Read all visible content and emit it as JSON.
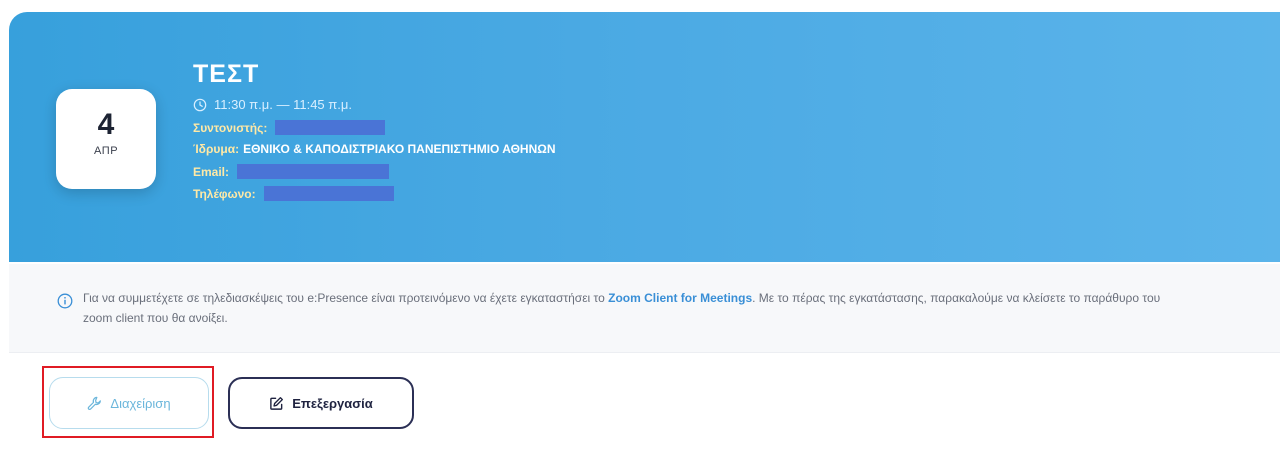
{
  "event": {
    "title": "ΤΕΣΤ",
    "time": "11:30 π.μ. — 11:45 π.μ.",
    "date": {
      "day": "4",
      "month": "ΑΠΡ"
    },
    "coordinator_label": "Συντονιστής:",
    "coordinator_value": "",
    "institution_label": "Ίδρυμα:",
    "institution_value": "ΕΘΝΙΚΟ & ΚΑΠΟΔΙΣΤΡΙΑΚΟ ΠΑΝΕΠΙΣΤΗΜΙΟ ΑΘΗΝΩΝ",
    "email_label": "Email:",
    "email_value": "",
    "phone_label": "Τηλέφωνο:",
    "phone_value": ""
  },
  "notice": {
    "text_before": "Για να συμμετέχετε σε τηλεδιασκέψεις του e:Presence είναι προτεινόμενο να έχετε εγκαταστήσει το ",
    "link": "Zoom Client for Meetings",
    "text_after": ". Με το πέρας της εγκατάστασης, παρακαλούμε να κλείσετε το παράθυρο του zoom client που θα ανοίξει."
  },
  "actions": {
    "manage_label": "Διαχείριση",
    "edit_label": "Επεξεργασία"
  },
  "colors": {
    "hero": "#4aa9e3",
    "label_yellow": "#ffe9a6",
    "link": "#3a8fd6",
    "highlight": "#e01b24",
    "edit_border": "#2b2f55"
  }
}
